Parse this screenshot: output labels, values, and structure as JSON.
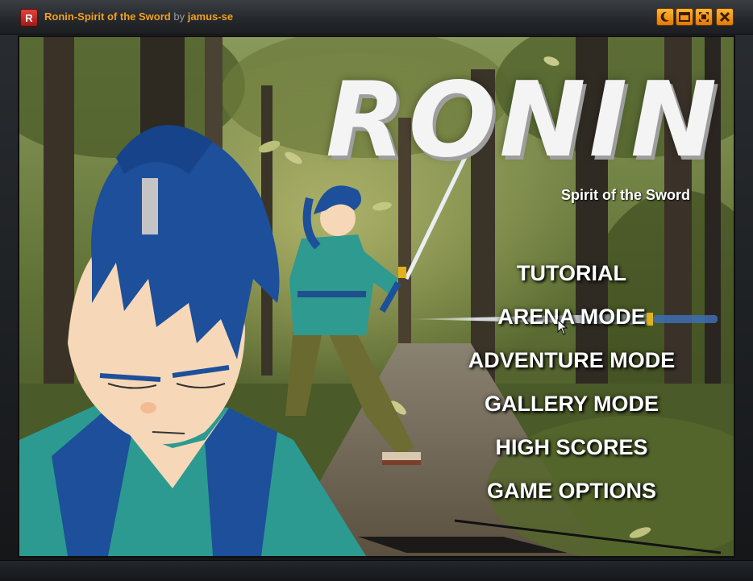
{
  "window": {
    "icon_letter": "R",
    "title": "Ronin-Spirit of the Sword",
    "by": "by",
    "author": "jamus-se",
    "accent": "#f0a020",
    "buttons": [
      "moon-icon",
      "restore-icon",
      "fullscreen-icon",
      "close-icon"
    ]
  },
  "game": {
    "logo_title": "RONIN",
    "logo_subtitle": "Spirit of the Sword",
    "menu": {
      "tutorial": "TUTORIAL",
      "arena": "ARENA MODE",
      "adventure": "ADVENTURE MODE",
      "gallery": "GALLERY MODE",
      "highscores": "HIGH SCORES",
      "options": "GAME OPTIONS"
    },
    "highlighted_item": "ARENA MODE"
  }
}
